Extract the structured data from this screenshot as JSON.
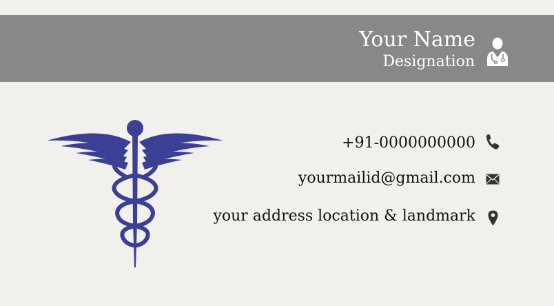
{
  "card": {
    "name": "Your Name",
    "designation": "Designation",
    "phone": "+91-0000000000",
    "email": "yourmailid@gmail.com",
    "address": "your address location & landmark"
  },
  "icons": {
    "profile": "doctor-icon",
    "logo": "caduceus-icon",
    "phone": "phone-icon",
    "email": "envelope-icon",
    "address": "map-pin-icon"
  },
  "colors": {
    "background": "#f1f0ec",
    "header": "#86888a",
    "header_text": "#ffffff",
    "logo": "#3b3f95",
    "body_text": "#111111",
    "icon": "#333333"
  }
}
